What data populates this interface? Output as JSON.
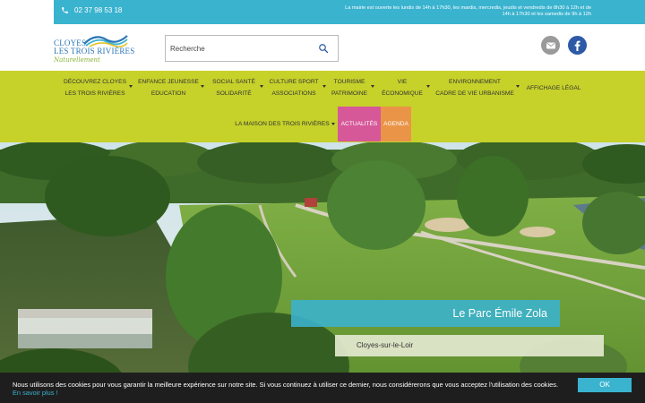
{
  "topbar": {
    "phone": "02 37 98 53 18",
    "hours": "La mairie est ouverte les lundis de 14h à 17h30, les mardis, mercredis, jeudis et vendredis de 8h30 à 12h et de 14h à 17h30 et les samedis de 9h à 12h"
  },
  "logo": {
    "line1": "CLOYES",
    "line2": "LES TROIS RIVIÈRES",
    "tagline": "Naturellement"
  },
  "search": {
    "placeholder": "Recherche"
  },
  "nav": {
    "items": [
      {
        "line1": "DÉCOUVREZ CLOYES",
        "line2": "LES TROIS RIVIÈRES"
      },
      {
        "line1": "ENFANCE JEUNESSE",
        "line2": "EDUCATION"
      },
      {
        "line1": "SOCIAL SANTÉ",
        "line2": "SOLIDARITÉ"
      },
      {
        "line1": "CULTURE SPORT",
        "line2": "ASSOCIATIONS"
      },
      {
        "line1": "TOURISME",
        "line2": "PATRIMOINE"
      },
      {
        "line1": "VIE",
        "line2": "ÉCONOMIQUE"
      },
      {
        "line1": "ENVIRONNEMENT",
        "line2": "CADRE DE VIE URBANISME"
      },
      {
        "line1": "AFFICHAGE LÉGAL"
      },
      {
        "line1": "LA MAISON DES TROIS RIVIÈRES"
      }
    ],
    "actualites": "ACTUALITÉS",
    "agenda": "AGENDA"
  },
  "hero": {
    "title": "Le Parc Émile Zola",
    "location": "Cloyes-sur-le-Loir"
  },
  "cookie": {
    "text": "Nous utilisons des cookies pour vous garantir la meilleure expérience sur notre site. Si vous continuez à utiliser ce dernier, nous considérerons que vous acceptez l'utilisation des cookies.",
    "link": "En savoir plus !",
    "ok": "OK"
  },
  "colors": {
    "accent": "#3ab3cf",
    "nav_bg": "#c6d12a",
    "actualites_bg": "#d65899",
    "agenda_bg": "#ea9448",
    "facebook": "#2d5aa6"
  },
  "icons": [
    "phone-icon",
    "search-icon",
    "mail-icon",
    "facebook-icon",
    "chevron-down-icon"
  ]
}
